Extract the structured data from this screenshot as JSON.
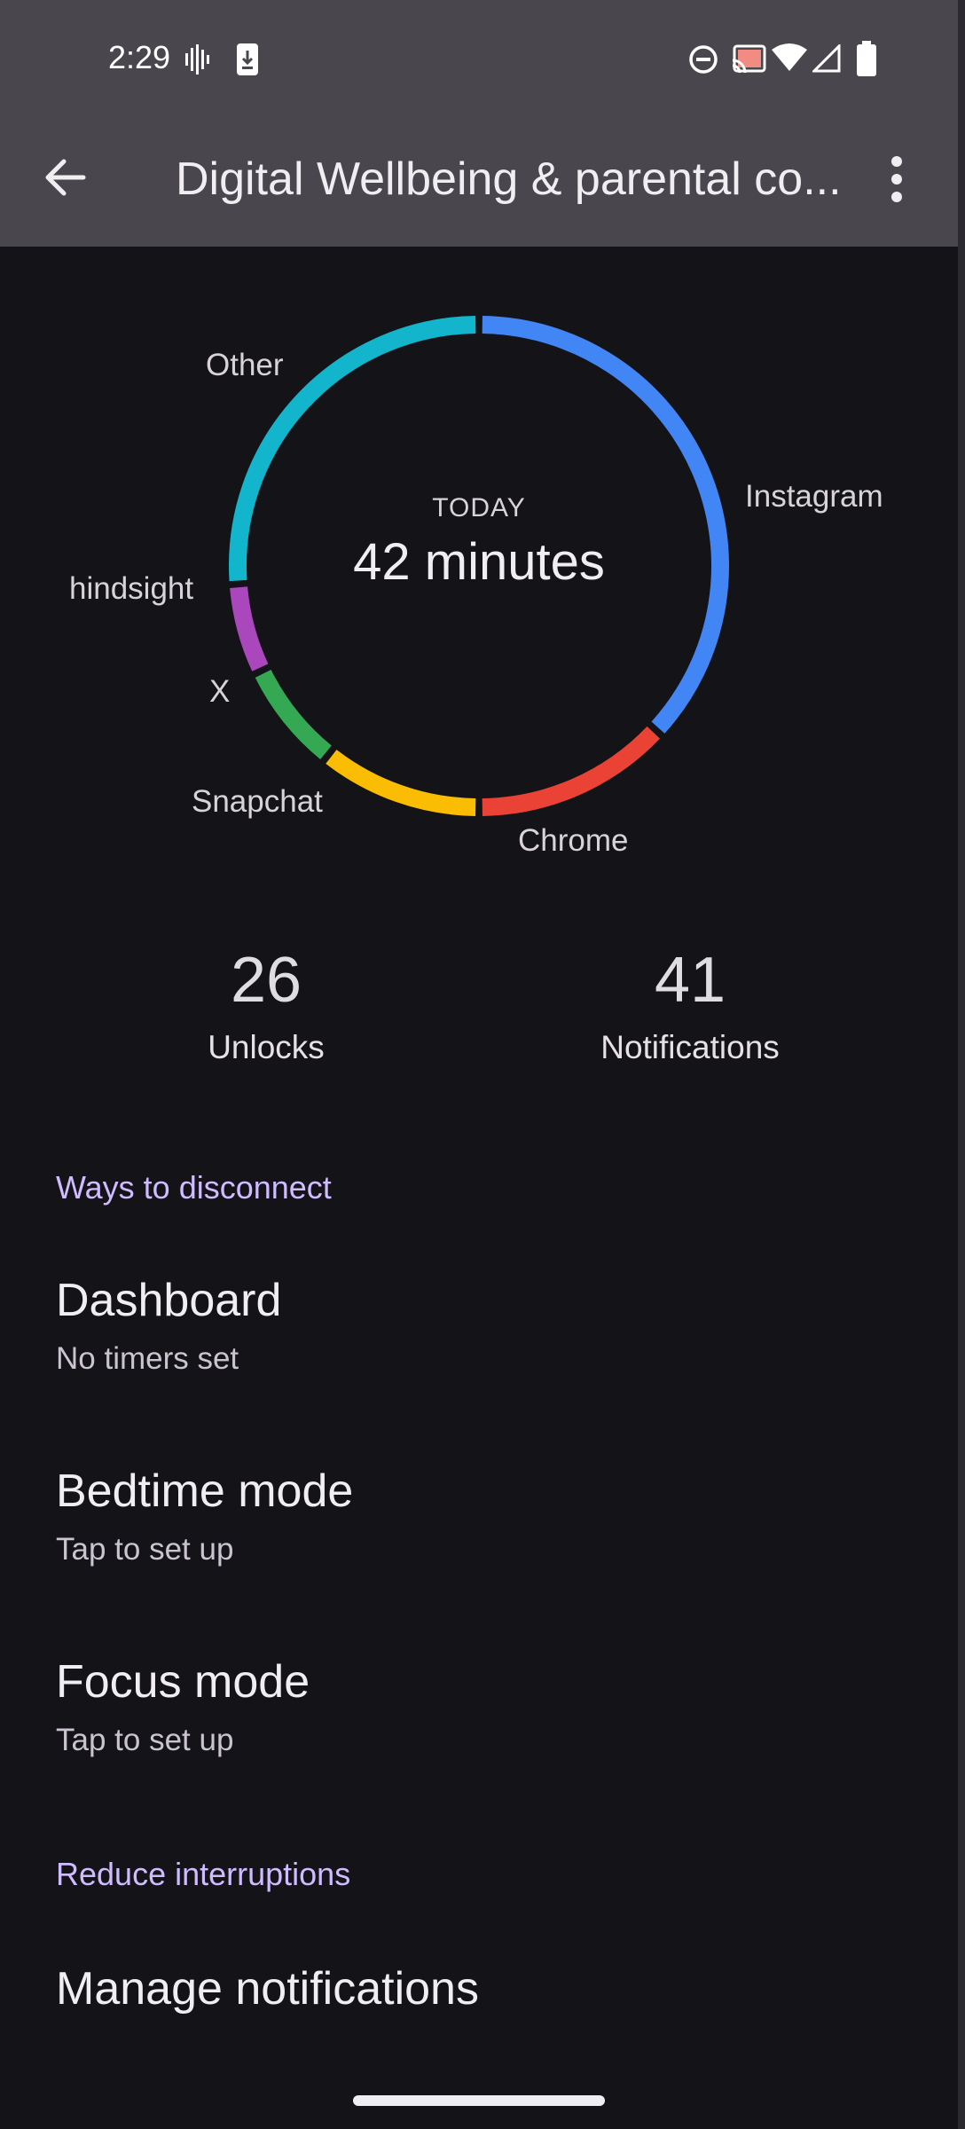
{
  "status": {
    "time": "2:29"
  },
  "app_bar": {
    "title": "Digital Wellbeing & parental co..."
  },
  "usage": {
    "period_label": "TODAY",
    "total": "42 minutes"
  },
  "chart_data": {
    "type": "pie",
    "categories": [
      "Instagram",
      "Chrome",
      "Snapchat",
      "X",
      "hindsight",
      "Other"
    ],
    "values": [
      15.5,
      5.5,
      4.5,
      3,
      2.5,
      11
    ],
    "colors": [
      "#4285f4",
      "#ea4335",
      "#fbbc04",
      "#34a853",
      "#ab47bc",
      "#12b5cb"
    ]
  },
  "stats": {
    "unlocks_value": "26",
    "unlocks_label": "Unlocks",
    "notifications_value": "41",
    "notifications_label": "Notifications"
  },
  "sections": {
    "disconnect_header": "Ways to disconnect",
    "interruptions_header": "Reduce interruptions"
  },
  "items": {
    "dashboard_title": "Dashboard",
    "dashboard_sub": "No timers set",
    "bedtime_title": "Bedtime mode",
    "bedtime_sub": "Tap to set up",
    "focus_title": "Focus mode",
    "focus_sub": "Tap to set up",
    "notifications_title": "Manage notifications"
  }
}
